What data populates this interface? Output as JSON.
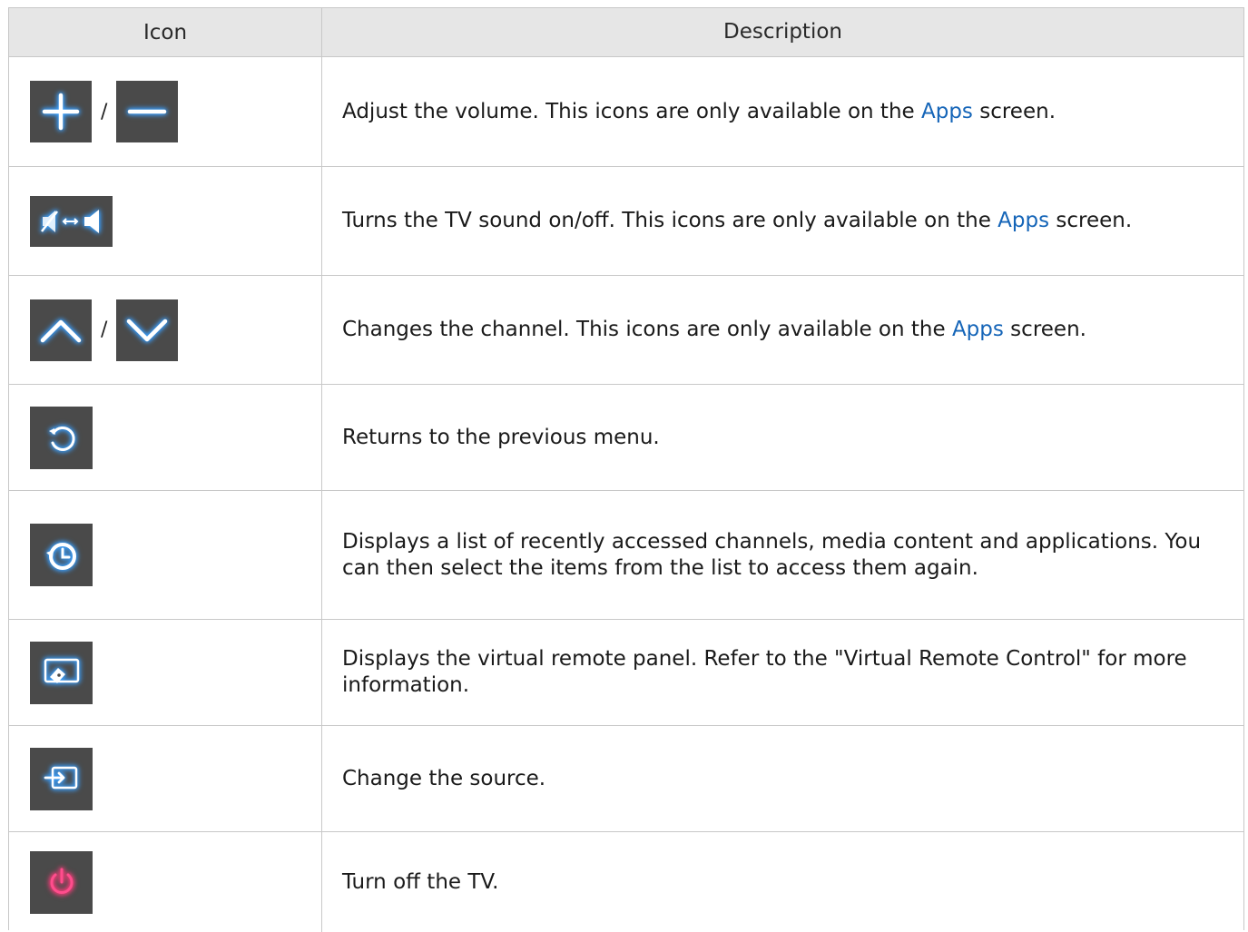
{
  "table": {
    "headers": {
      "icon": "Icon",
      "description": "Description"
    },
    "rows": [
      {
        "icons": [
          "plus-icon",
          "minus-icon"
        ],
        "separator": "/",
        "desc_before": "Adjust the volume. This icons are only available on the ",
        "desc_link": "Apps",
        "desc_after": " screen."
      },
      {
        "icons": [
          "mute-toggle-icon"
        ],
        "desc_before": "Turns the TV sound on/off. This icons are only available on the ",
        "desc_link": "Apps",
        "desc_after": " screen."
      },
      {
        "icons": [
          "chevron-up-icon",
          "chevron-down-icon"
        ],
        "separator": "/",
        "desc_before": "Changes the channel. This icons are only available on the ",
        "desc_link": "Apps",
        "desc_after": " screen."
      },
      {
        "icons": [
          "return-icon"
        ],
        "desc_before": "Returns to the previous menu."
      },
      {
        "icons": [
          "history-icon"
        ],
        "desc_before": "Displays a list of recently accessed channels, media content and applications. You can then select the items from the list to access them again."
      },
      {
        "icons": [
          "virtual-remote-icon"
        ],
        "desc_before": "Displays the virtual remote panel. Refer to the \"Virtual Remote Control\" for more information."
      },
      {
        "icons": [
          "source-icon"
        ],
        "desc_before": "Change the source."
      },
      {
        "icons": [
          "power-icon"
        ],
        "desc_before": "Turn off the TV."
      }
    ]
  },
  "colors": {
    "icon_glow": "#3aa0ff",
    "power_glow": "#ff3a7a",
    "link": "#1565b8",
    "button_bg": "#4a4a4a",
    "header_bg": "#e6e6e6"
  }
}
